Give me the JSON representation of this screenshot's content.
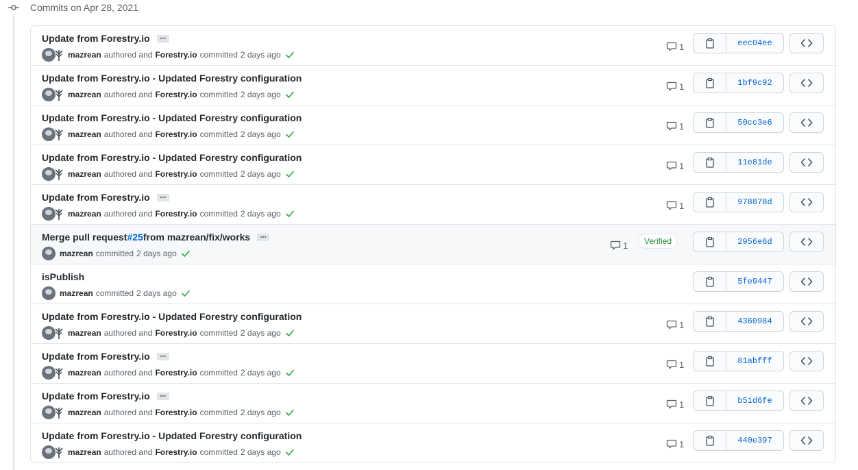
{
  "group": {
    "title": "Commits on Apr 28, 2021"
  },
  "labels": {
    "authored_and": "authored and",
    "committed": "committed",
    "verified": "Verified"
  },
  "commits": [
    {
      "message": "Update from Forestry.io",
      "ellipsis": true,
      "author": "mazrean",
      "coauthor": "Forestry.io",
      "time": "2 days ago",
      "comments": "1",
      "sha": "eec04ee"
    },
    {
      "message": "Update from Forestry.io - Updated Forestry configuration",
      "ellipsis": false,
      "author": "mazrean",
      "coauthor": "Forestry.io",
      "time": "2 days ago",
      "comments": "1",
      "sha": "1bf9c92"
    },
    {
      "message": "Update from Forestry.io - Updated Forestry configuration",
      "ellipsis": false,
      "author": "mazrean",
      "coauthor": "Forestry.io",
      "time": "2 days ago",
      "comments": "1",
      "sha": "50cc3e6"
    },
    {
      "message": "Update from Forestry.io - Updated Forestry configuration",
      "ellipsis": false,
      "author": "mazrean",
      "coauthor": "Forestry.io",
      "time": "2 days ago",
      "comments": "1",
      "sha": "11e81de"
    },
    {
      "message": "Update from Forestry.io",
      "ellipsis": true,
      "author": "mazrean",
      "coauthor": "Forestry.io",
      "time": "2 days ago",
      "comments": "1",
      "sha": "978878d"
    },
    {
      "message_prefix": "Merge pull request ",
      "pr_link": "#25",
      "message_suffix": " from mazrean/fix/works",
      "ellipsis": true,
      "author": "mazrean",
      "time": "2 days ago",
      "comments": "1",
      "verified": true,
      "sha": "2956e6d"
    },
    {
      "message": "isPublish",
      "ellipsis": false,
      "author": "mazrean",
      "time": "2 days ago",
      "sha": "5fe9447"
    },
    {
      "message": "Update from Forestry.io - Updated Forestry configuration",
      "ellipsis": false,
      "author": "mazrean",
      "coauthor": "Forestry.io",
      "time": "2 days ago",
      "comments": "1",
      "sha": "4360984"
    },
    {
      "message": "Update from Forestry.io",
      "ellipsis": true,
      "author": "mazrean",
      "coauthor": "Forestry.io",
      "time": "2 days ago",
      "comments": "1",
      "sha": "81abfff"
    },
    {
      "message": "Update from Forestry.io",
      "ellipsis": true,
      "author": "mazrean",
      "coauthor": "Forestry.io",
      "time": "2 days ago",
      "comments": "1",
      "sha": "b51d6fe"
    },
    {
      "message": "Update from Forestry.io - Updated Forestry configuration",
      "ellipsis": false,
      "author": "mazrean",
      "coauthor": "Forestry.io",
      "time": "2 days ago",
      "comments": "1",
      "sha": "440e397"
    }
  ],
  "colors": {
    "check": "#28a745",
    "link": "#0366d6",
    "verified": "#22863a"
  }
}
